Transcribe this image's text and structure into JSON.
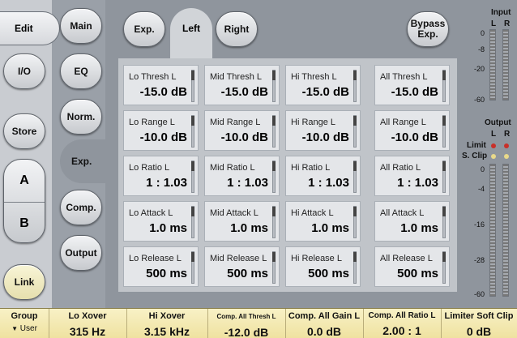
{
  "nav": {
    "edit": "Edit",
    "io": "I/O",
    "store": "Store",
    "a": "A",
    "b": "B",
    "link": "Link"
  },
  "sections": {
    "main": "Main",
    "eq": "EQ",
    "norm": "Norm.",
    "exp": "Exp.",
    "comp": "Comp.",
    "output": "Output"
  },
  "top": {
    "exp": "Exp.",
    "left": "Left",
    "right": "Right",
    "bypass_line1": "Bypass",
    "bypass_line2": "Exp."
  },
  "grid": [
    [
      {
        "label": "Lo Thresh L",
        "value": "-15.0 dB"
      },
      {
        "label": "Mid Thresh L",
        "value": "-15.0 dB"
      },
      {
        "label": "Hi Thresh L",
        "value": "-15.0 dB"
      },
      {
        "label": "All Thresh L",
        "value": "-15.0 dB"
      }
    ],
    [
      {
        "label": "Lo Range L",
        "value": "-10.0 dB"
      },
      {
        "label": "Mid Range L",
        "value": "-10.0 dB"
      },
      {
        "label": "Hi Range L",
        "value": "-10.0 dB"
      },
      {
        "label": "All Range L",
        "value": "-10.0 dB"
      }
    ],
    [
      {
        "label": "Lo Ratio L",
        "value": "1 : 1.03"
      },
      {
        "label": "Mid Ratio L",
        "value": "1 : 1.03"
      },
      {
        "label": "Hi Ratio L",
        "value": "1 : 1.03"
      },
      {
        "label": "All Ratio L",
        "value": "1 : 1.03"
      }
    ],
    [
      {
        "label": "Lo Attack L",
        "value": "1.0 ms"
      },
      {
        "label": "Mid Attack L",
        "value": "1.0 ms"
      },
      {
        "label": "Hi Attack L",
        "value": "1.0 ms"
      },
      {
        "label": "All Attack L",
        "value": "1.0 ms"
      }
    ],
    [
      {
        "label": "Lo Release L",
        "value": "500 ms"
      },
      {
        "label": "Mid Release L",
        "value": "500 ms"
      },
      {
        "label": "Hi Release L",
        "value": "500 ms"
      },
      {
        "label": "All Release L",
        "value": "500 ms"
      }
    ]
  ],
  "meters": {
    "input_title": "Input",
    "input_l": "L",
    "input_r": "R",
    "input_scale": [
      "0",
      "-8",
      "-20",
      "-60"
    ],
    "output_title": "Output",
    "output_l": "L",
    "output_r": "R",
    "limit": "Limit",
    "sclip": "S. Clip",
    "output_scale": [
      "0",
      "-4",
      "-16",
      "-28",
      "-60"
    ]
  },
  "footer": {
    "group_title": "Group",
    "group_value": "User",
    "items": [
      {
        "title": "Lo Xover",
        "value": "315 Hz"
      },
      {
        "title": "Hi Xover",
        "value": "3.15 kHz"
      },
      {
        "title": "Comp. All Thresh L",
        "value": "-12.0 dB"
      },
      {
        "title": "Comp. All Gain L",
        "value": "0.0 dB"
      },
      {
        "title": "Comp. All Ratio L",
        "value": "2.00 : 1"
      },
      {
        "title": "Limiter Soft Clip",
        "value": "0 dB"
      }
    ]
  },
  "colors": {
    "accent_yellow": "#efe2a0",
    "led_red": "#c8302a",
    "led_yellow": "#e8d98a"
  }
}
